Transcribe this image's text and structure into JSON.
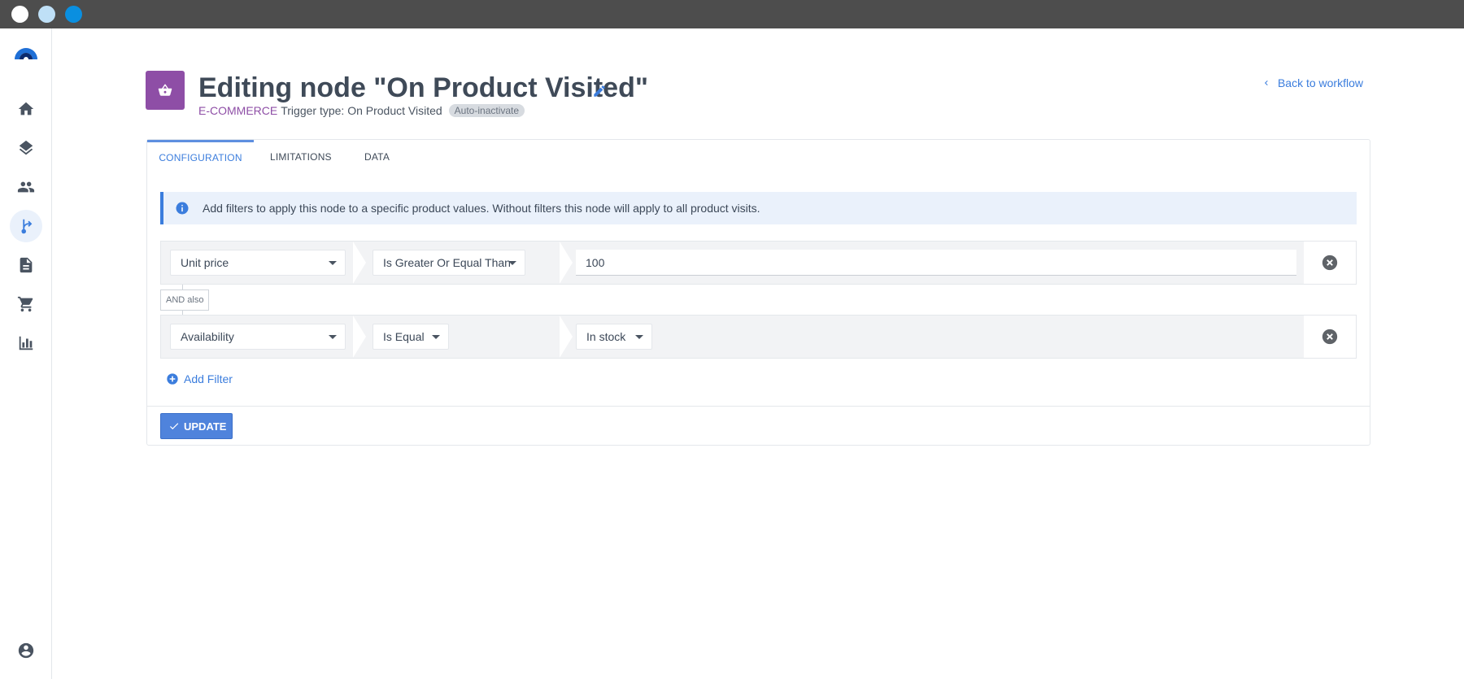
{
  "window": {
    "controls": [
      "close-dot",
      "minimize-dot",
      "maximize-dot"
    ]
  },
  "sidebar": {
    "items": [
      {
        "name": "home",
        "icon": "home-icon",
        "active": false
      },
      {
        "name": "layers",
        "icon": "layers-icon",
        "active": false
      },
      {
        "name": "users",
        "icon": "users-icon",
        "active": false
      },
      {
        "name": "workflows",
        "icon": "workflow-icon",
        "active": true
      },
      {
        "name": "documents",
        "icon": "document-icon",
        "active": false
      },
      {
        "name": "ecommerce",
        "icon": "cart-icon",
        "active": false
      },
      {
        "name": "reports",
        "icon": "bar-chart-icon",
        "active": false
      }
    ],
    "account_icon": "account-icon"
  },
  "header": {
    "title": "Editing node \"On Product Visited\"",
    "category": "E-COMMERCE",
    "trigger_text": "Trigger type: On Product Visited",
    "badge": "Auto-inactivate",
    "back_link": "Back to workflow",
    "node_color": "#8e4ea6"
  },
  "tabs": [
    {
      "label": "CONFIGURATION",
      "active": true
    },
    {
      "label": "LIMITATIONS",
      "active": false
    },
    {
      "label": "DATA",
      "active": false
    }
  ],
  "info": {
    "text": "Add filters to apply this node to a specific product values. Without filters this node will apply to all product visits."
  },
  "filters": [
    {
      "field": "Unit price",
      "operator": "Is Greater Or Equal Than",
      "value": "100"
    },
    {
      "field": "Availability",
      "operator": "Is Equal",
      "value": "In stock"
    }
  ],
  "connector_label": "AND also",
  "add_filter_label": "Add Filter",
  "update_label": "UPDATE",
  "colors": {
    "accent": "#3b7ddd",
    "button": "#4f83dc"
  }
}
